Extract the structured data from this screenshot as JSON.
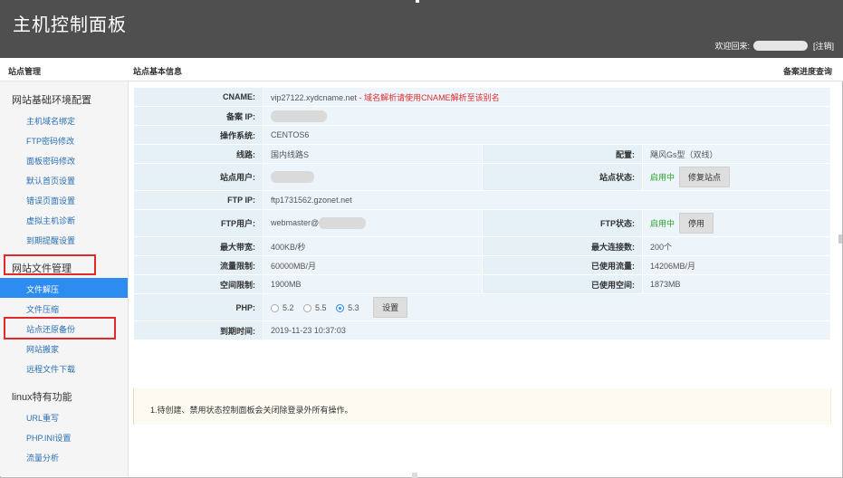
{
  "header": {
    "title": "主机控制面板",
    "welcome": "欢迎回来",
    "welcome_suffix": ":",
    "logout": "[注销]"
  },
  "subbar": {
    "left": "站点管理",
    "center": "站点基本信息",
    "right": "备案进度查询"
  },
  "sidebar": {
    "group1": "网站基础环境配置",
    "group1_items": [
      "主机域名绑定",
      "FTP密码修改",
      "面板密码修改",
      "默认首页设置",
      "错误页面设置",
      "虚拟主机诊断",
      "到期提醒设置"
    ],
    "group2": "网站文件管理",
    "group2_items": [
      "文件解压",
      "文件压缩",
      "站点还原备份",
      "网站搬家",
      "远程文件下载"
    ],
    "group3": "linux特有功能",
    "group3_items": [
      "URL重写",
      "PHP.INI设置",
      "流量分析"
    ]
  },
  "info": {
    "cname_label": "CNAME:",
    "cname_value": "vip27122.xydcname.net",
    "cname_sep": " - ",
    "cname_note": "域名解析请使用CNAME解析至该别名",
    "beian_label": "备案 IP:",
    "os_label": "操作系统:",
    "os_value": "CENTOS6",
    "line_label": "线路:",
    "line_value": "国内线路S",
    "config_label": "配置:",
    "config_value": "飓风Gs型（双线）",
    "siteuser_label": "站点用户:",
    "sitestatus_label": "站点状态:",
    "sitestatus_value": "启用中",
    "repair_btn": "修复站点",
    "ftpip_label": "FTP IP:",
    "ftpip_value": "ftp1731562.gzonet.net",
    "ftpuser_label": "FTP用户:",
    "ftpuser_value": "webmaster@",
    "ftpstatus_label": "FTP状态:",
    "ftpstatus_value": "启用中",
    "disable_btn": "停用",
    "bw_label": "最大带宽:",
    "bw_value": "400KB/秒",
    "conn_label": "最大连接数:",
    "conn_value": "200个",
    "traffic_label": "流量限制:",
    "traffic_value": "60000MB/月",
    "traffic_used_label": "已使用流量:",
    "traffic_used_value": "14206MB/月",
    "space_label": "空间限制:",
    "space_value": "1900MB",
    "space_used_label": "已使用空间:",
    "space_used_value": "1873MB",
    "php_label": "PHP:",
    "php_options": [
      "5.2",
      "5.5",
      "5.3"
    ],
    "php_selected": "5.3",
    "php_btn": "设置",
    "expire_label": "到期时间:",
    "expire_value": "2019-11-23 10:37:03"
  },
  "notice": "1.待创建、禁用状态控制面板会关闭除登录外所有操作。",
  "colors": {
    "header_bg": "#4f4f4f",
    "accent": "#2d8cf0",
    "link": "#2a6fb3",
    "highlight_box": "#e02b2b",
    "status_green": "#2aa12a"
  }
}
